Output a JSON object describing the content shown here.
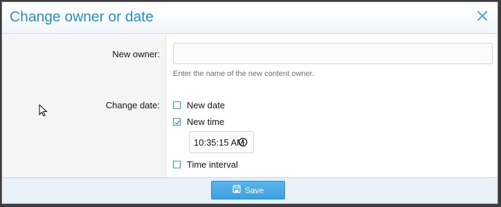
{
  "dialog": {
    "title": "Change owner or date",
    "close_icon": "close-icon"
  },
  "owner": {
    "label": "New owner:",
    "value": "",
    "placeholder": "",
    "hint": "Enter the name of the new content owner."
  },
  "date": {
    "label": "Change date:",
    "options": [
      {
        "label": "New date",
        "checked": false
      },
      {
        "label": "New time",
        "checked": true
      },
      {
        "label": "Time interval",
        "checked": false
      }
    ],
    "time_value": "10:35:15 AM",
    "time_icon": "clock-icon"
  },
  "footer": {
    "save_label": "Save",
    "save_icon": "save-icon"
  },
  "colors": {
    "accent": "#2b8fc6",
    "button": "#4aa7e3",
    "footer": "#e9f1f8"
  }
}
